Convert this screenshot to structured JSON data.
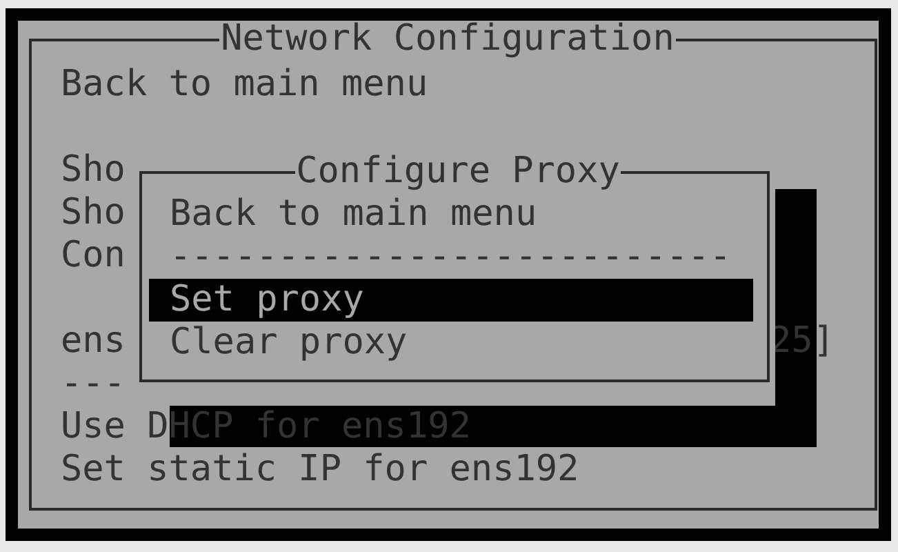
{
  "window": {
    "title": "Network Configuration"
  },
  "menu": {
    "items": [
      {
        "kind": "item",
        "label": "Back to main menu"
      },
      {
        "kind": "gap"
      },
      {
        "kind": "item",
        "label": "Sho"
      },
      {
        "kind": "item",
        "label": "Sho"
      },
      {
        "kind": "item",
        "label": "Con"
      },
      {
        "kind": "gap"
      },
      {
        "kind": "item",
        "label": "ens",
        "trailing": "25]"
      },
      {
        "kind": "separator",
        "label": "---"
      },
      {
        "kind": "item",
        "label": "Use DHCP for ens192"
      },
      {
        "kind": "item",
        "label": "Set static IP for ens192"
      }
    ]
  },
  "dialog": {
    "title": "Configure Proxy",
    "items": [
      {
        "kind": "item",
        "label": "Back to main menu",
        "selected": false
      },
      {
        "kind": "separator",
        "label": "--------------------------"
      },
      {
        "kind": "item",
        "label": "Set proxy",
        "selected": true
      },
      {
        "kind": "item",
        "label": "Clear proxy",
        "selected": false
      }
    ]
  }
}
